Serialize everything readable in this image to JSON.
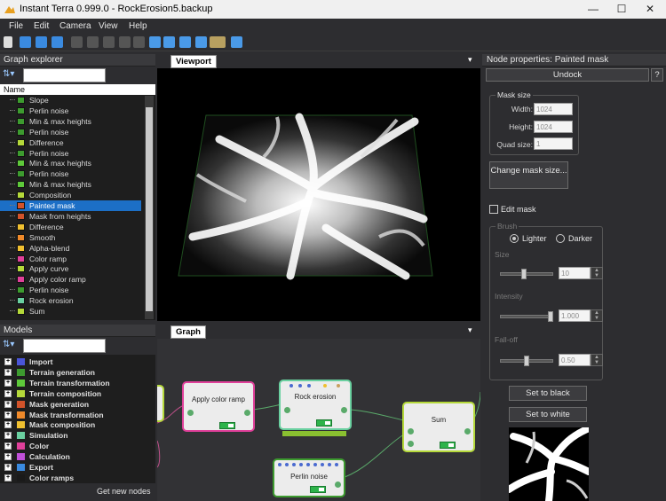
{
  "window": {
    "title": "Instant Terra 0.999.0 - RockErosion5.backup",
    "minimize": "—",
    "maximize": "☐",
    "close": "✕"
  },
  "menu": [
    "File",
    "Edit",
    "Camera",
    "View",
    "Help"
  ],
  "graph_explorer": {
    "title": "Graph explorer",
    "column": "Name",
    "items": [
      {
        "label": "Slope",
        "color": "#3d9b2f"
      },
      {
        "label": "Perlin noise",
        "color": "#3d9b2f"
      },
      {
        "label": "Min & max heights",
        "color": "#3d9b2f"
      },
      {
        "label": "Perlin noise",
        "color": "#3d9b2f"
      },
      {
        "label": "Difference",
        "color": "#b5d93a"
      },
      {
        "label": "Perlin noise",
        "color": "#3d9b2f"
      },
      {
        "label": "Min & max heights",
        "color": "#5ec93a"
      },
      {
        "label": "Perlin noise",
        "color": "#3d9b2f"
      },
      {
        "label": "Min & max heights",
        "color": "#5ec93a"
      },
      {
        "label": "Composition",
        "color": "#b5d93a"
      },
      {
        "label": "Painted mask",
        "color": "#d2532a",
        "selected": true
      },
      {
        "label": "Mask from heights",
        "color": "#d2532a"
      },
      {
        "label": "Difference",
        "color": "#f0c030"
      },
      {
        "label": "Smooth",
        "color": "#f08a2a"
      },
      {
        "label": "Alpha-blend",
        "color": "#f0c030"
      },
      {
        "label": "Color ramp",
        "color": "#e0409a"
      },
      {
        "label": "Apply curve",
        "color": "#b5d93a"
      },
      {
        "label": "Apply color ramp",
        "color": "#e0409a"
      },
      {
        "label": "Perlin noise",
        "color": "#3d9b2f"
      },
      {
        "label": "Rock erosion",
        "color": "#6ad0a0"
      },
      {
        "label": "Sum",
        "color": "#b5d93a"
      }
    ]
  },
  "models": {
    "title": "Models",
    "items": [
      {
        "label": "Import",
        "color": "#4a55d8"
      },
      {
        "label": "Terrain generation",
        "color": "#3d9b2f"
      },
      {
        "label": "Terrain transformation",
        "color": "#5ec93a"
      },
      {
        "label": "Terrain composition",
        "color": "#b5d93a"
      },
      {
        "label": "Mask generation",
        "color": "#d2532a"
      },
      {
        "label": "Mask transformation",
        "color": "#f08a2a"
      },
      {
        "label": "Mask composition",
        "color": "#f0c030"
      },
      {
        "label": "Simulation",
        "color": "#6ad0a0"
      },
      {
        "label": "Color",
        "color": "#e0409a"
      },
      {
        "label": "Calculation",
        "color": "#c050d8"
      },
      {
        "label": "Export",
        "color": "#3a8ae0"
      },
      {
        "label": "Color ramps",
        "color": "#1a1a1a"
      }
    ],
    "get_new": "Get new nodes"
  },
  "viewport": {
    "tab": "Viewport"
  },
  "graph": {
    "tab": "Graph",
    "nodes": {
      "apply": "Apply color ramp",
      "rock": "Rock erosion",
      "sum": "Sum",
      "perlin": "Perlin noise"
    }
  },
  "properties": {
    "title": "Node properties: Painted mask",
    "undock": "Undock",
    "help": "?",
    "mask_size": {
      "group": "Mask size",
      "width_label": "Width:",
      "width": "1024",
      "height_label": "Height:",
      "height": "1024",
      "quad_label": "Quad size:",
      "quad": "1"
    },
    "change_btn": "Change mask size...",
    "edit_mask": "Edit mask",
    "brush": {
      "group": "Brush",
      "lighter": "Lighter",
      "darker": "Darker",
      "size_label": "Size",
      "size": "10",
      "intensity_label": "Intensity",
      "intensity": "1.000",
      "falloff_label": "Fall-off",
      "falloff": "0.50",
      "size_value": 0.45,
      "intensity_value": 1.0,
      "falloff_value": 0.5
    },
    "set_black": "Set to black",
    "set_white": "Set to white"
  }
}
